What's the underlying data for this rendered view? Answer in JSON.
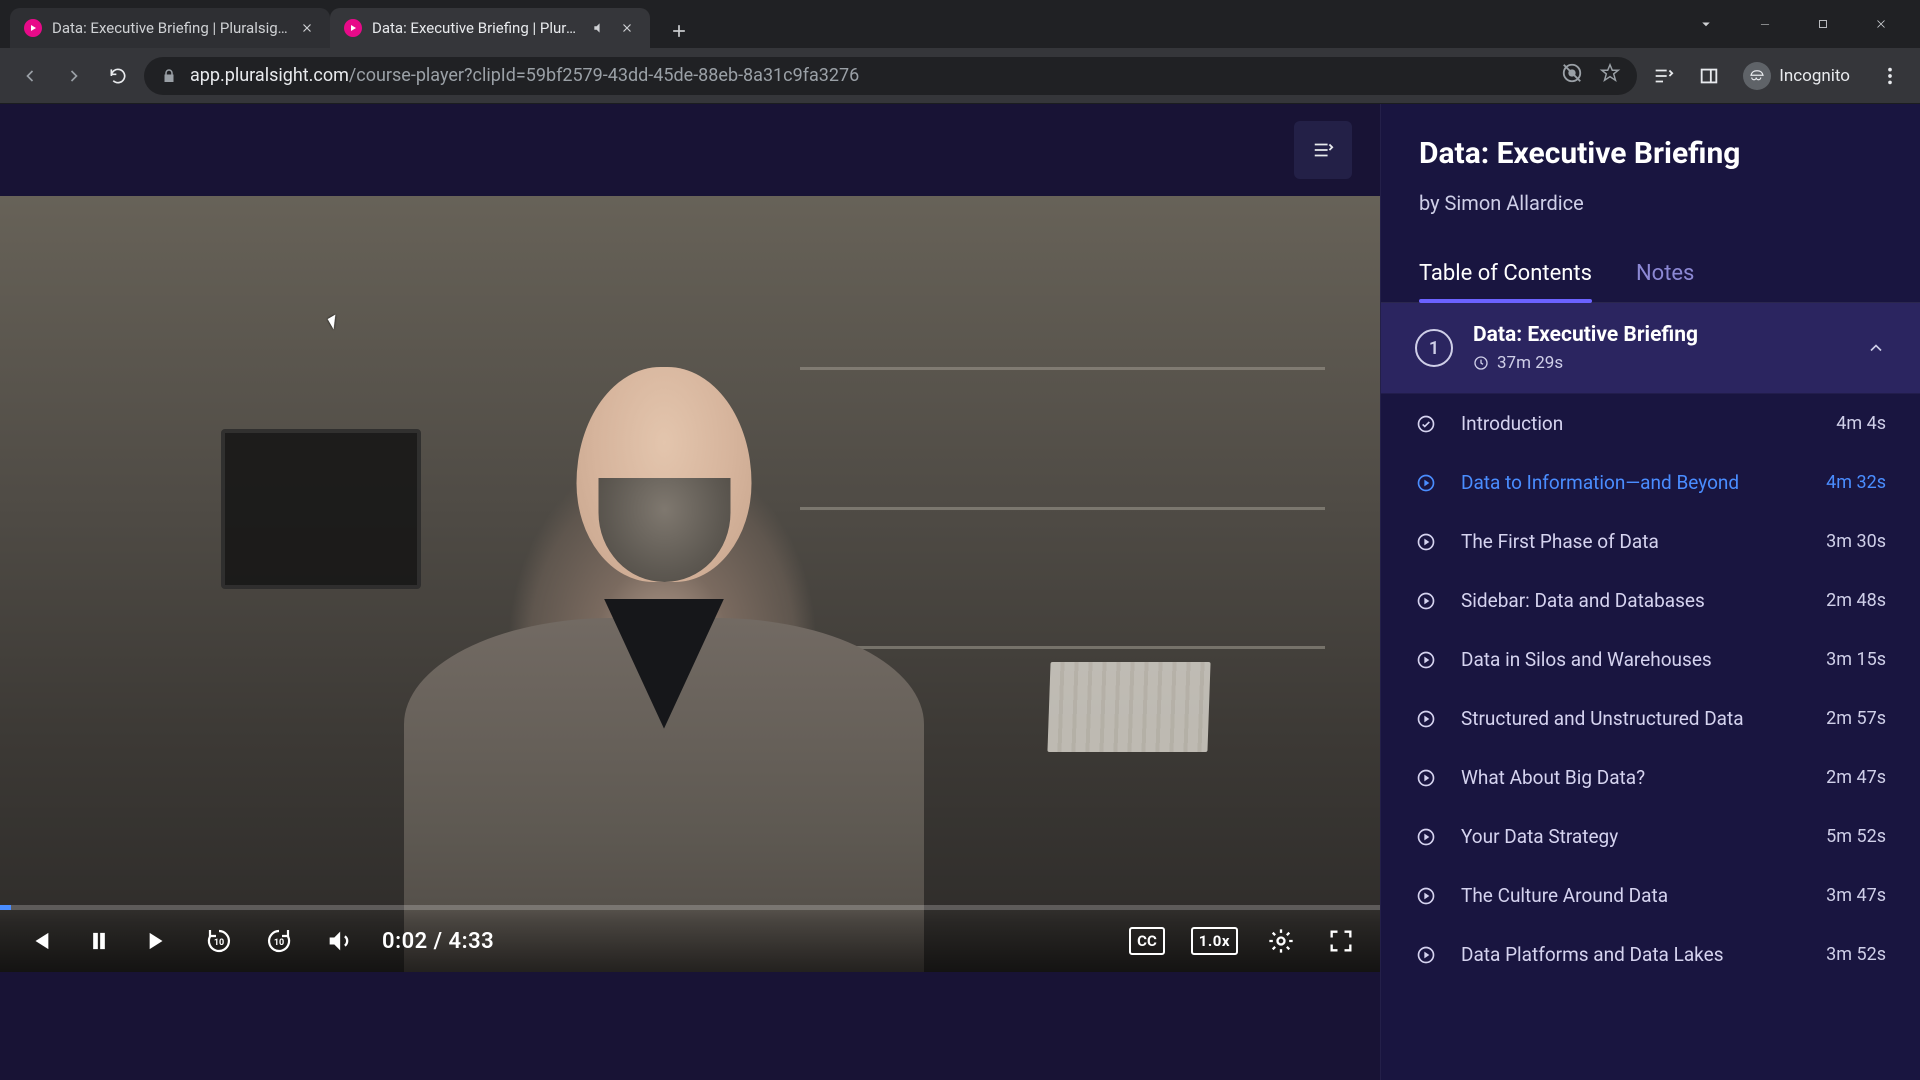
{
  "browser": {
    "tabs": [
      {
        "title": "Data: Executive Briefing | Pluralsight",
        "active": false,
        "audio": false
      },
      {
        "title": "Data: Executive Briefing | Pluralsight",
        "active": true,
        "audio": true
      }
    ],
    "url_host": "app.pluralsight.com",
    "url_path": "/course-player?clipId=59bf2579-43dd-45de-88eb-8a31c9fa3276",
    "profile_label": "Incognito"
  },
  "course": {
    "title": "Data: Executive Briefing",
    "byline": "by Simon Allardice",
    "tabs": {
      "toc": "Table of Contents",
      "notes": "Notes"
    },
    "module": {
      "number": "1",
      "title": "Data: Executive Briefing",
      "duration": "37m 29s"
    },
    "clips": [
      {
        "title": "Introduction",
        "duration": "4m 4s",
        "state": "completed"
      },
      {
        "title": "Data to Information—and Beyond",
        "duration": "4m 32s",
        "state": "playing"
      },
      {
        "title": "The First Phase of Data",
        "duration": "3m 30s",
        "state": "unwatched"
      },
      {
        "title": "Sidebar: Data and Databases",
        "duration": "2m 48s",
        "state": "unwatched"
      },
      {
        "title": "Data in Silos and Warehouses",
        "duration": "3m 15s",
        "state": "unwatched"
      },
      {
        "title": "Structured and Unstructured Data",
        "duration": "2m 57s",
        "state": "unwatched"
      },
      {
        "title": "What About Big Data?",
        "duration": "2m 47s",
        "state": "unwatched"
      },
      {
        "title": "Your Data Strategy",
        "duration": "5m 52s",
        "state": "unwatched"
      },
      {
        "title": "The Culture Around Data",
        "duration": "3m 47s",
        "state": "unwatched"
      },
      {
        "title": "Data Platforms and Data Lakes",
        "duration": "3m 52s",
        "state": "unwatched"
      }
    ]
  },
  "player": {
    "current_time": "0:02",
    "total_time": "4:33",
    "time_separator": " / ",
    "speed_label": "1.0x",
    "cc_label": "CC",
    "progress_pct": 0.8
  }
}
